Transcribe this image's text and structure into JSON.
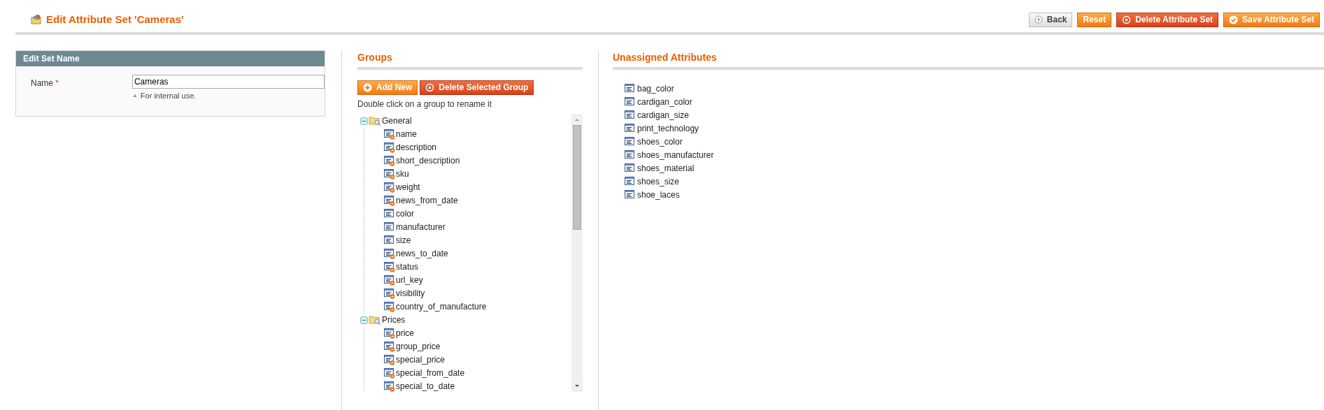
{
  "page": {
    "title": "Edit Attribute Set 'Cameras'"
  },
  "actions": [
    {
      "label": "Back",
      "kind": "back"
    },
    {
      "label": "Reset",
      "kind": "primary"
    },
    {
      "label": "Delete Attribute Set",
      "kind": "delete"
    },
    {
      "label": "Save Attribute Set",
      "kind": "save"
    }
  ],
  "edit_set_name": {
    "title": "Edit Set Name",
    "label": "Name",
    "required_mark": "*",
    "value": "Cameras",
    "note_icon": "▲",
    "note": "For internal use."
  },
  "groups": {
    "title": "Groups",
    "buttons": [
      {
        "label": "Add New",
        "kind": "add"
      },
      {
        "label": "Delete Selected Group",
        "kind": "delete"
      }
    ],
    "hint": "Double click on a group to rename it",
    "tree": [
      {
        "label": "General",
        "expanded": true,
        "children": [
          {
            "label": "name",
            "kind": "system"
          },
          {
            "label": "description",
            "kind": "system"
          },
          {
            "label": "short_description",
            "kind": "system"
          },
          {
            "label": "sku",
            "kind": "system"
          },
          {
            "label": "weight",
            "kind": "system"
          },
          {
            "label": "news_from_date",
            "kind": "system"
          },
          {
            "label": "color",
            "kind": "user"
          },
          {
            "label": "manufacturer",
            "kind": "user"
          },
          {
            "label": "size",
            "kind": "user"
          },
          {
            "label": "news_to_date",
            "kind": "system"
          },
          {
            "label": "status",
            "kind": "system"
          },
          {
            "label": "url_key",
            "kind": "system"
          },
          {
            "label": "visibility",
            "kind": "system"
          },
          {
            "label": "country_of_manufacture",
            "kind": "system"
          }
        ]
      },
      {
        "label": "Prices",
        "expanded": true,
        "children": [
          {
            "label": "price",
            "kind": "system"
          },
          {
            "label": "group_price",
            "kind": "system"
          },
          {
            "label": "special_price",
            "kind": "system"
          },
          {
            "label": "special_from_date",
            "kind": "system"
          },
          {
            "label": "special_to_date",
            "kind": "system"
          }
        ]
      }
    ]
  },
  "unassigned": {
    "title": "Unassigned Attributes",
    "items": [
      "bag_color",
      "cardigan_color",
      "cardigan_size",
      "print_technology",
      "shoes_color",
      "shoes_manufacturer",
      "shoes_material",
      "shoes_size",
      "shoe_laces"
    ]
  }
}
